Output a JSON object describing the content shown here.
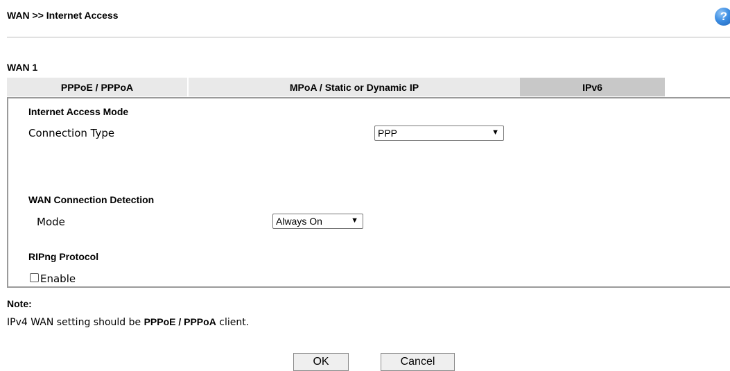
{
  "header": {
    "title": "WAN >> Internet Access",
    "help_icon": "?"
  },
  "wan_label": "WAN 1",
  "tabs": [
    {
      "label": "PPPoE / PPPoA",
      "active": false
    },
    {
      "label": "MPoA / Static or Dynamic IP",
      "active": false
    },
    {
      "label": "IPv6",
      "active": true
    }
  ],
  "internet_access_mode": {
    "heading": "Internet Access Mode",
    "connection_type_label": "Connection Type",
    "connection_type_value": "PPP"
  },
  "wan_connection_detection": {
    "heading": "WAN Connection Detection",
    "mode_label": "Mode",
    "mode_value": "Always On"
  },
  "ripng": {
    "heading": "RIPng Protocol",
    "enable_label": "Enable",
    "enabled": false
  },
  "note": {
    "heading": "Note:",
    "text_prefix": "IPv4 WAN setting should be ",
    "text_bold": "PPPoE / PPPoA",
    "text_suffix": " client."
  },
  "buttons": {
    "ok": "OK",
    "cancel": "Cancel"
  }
}
